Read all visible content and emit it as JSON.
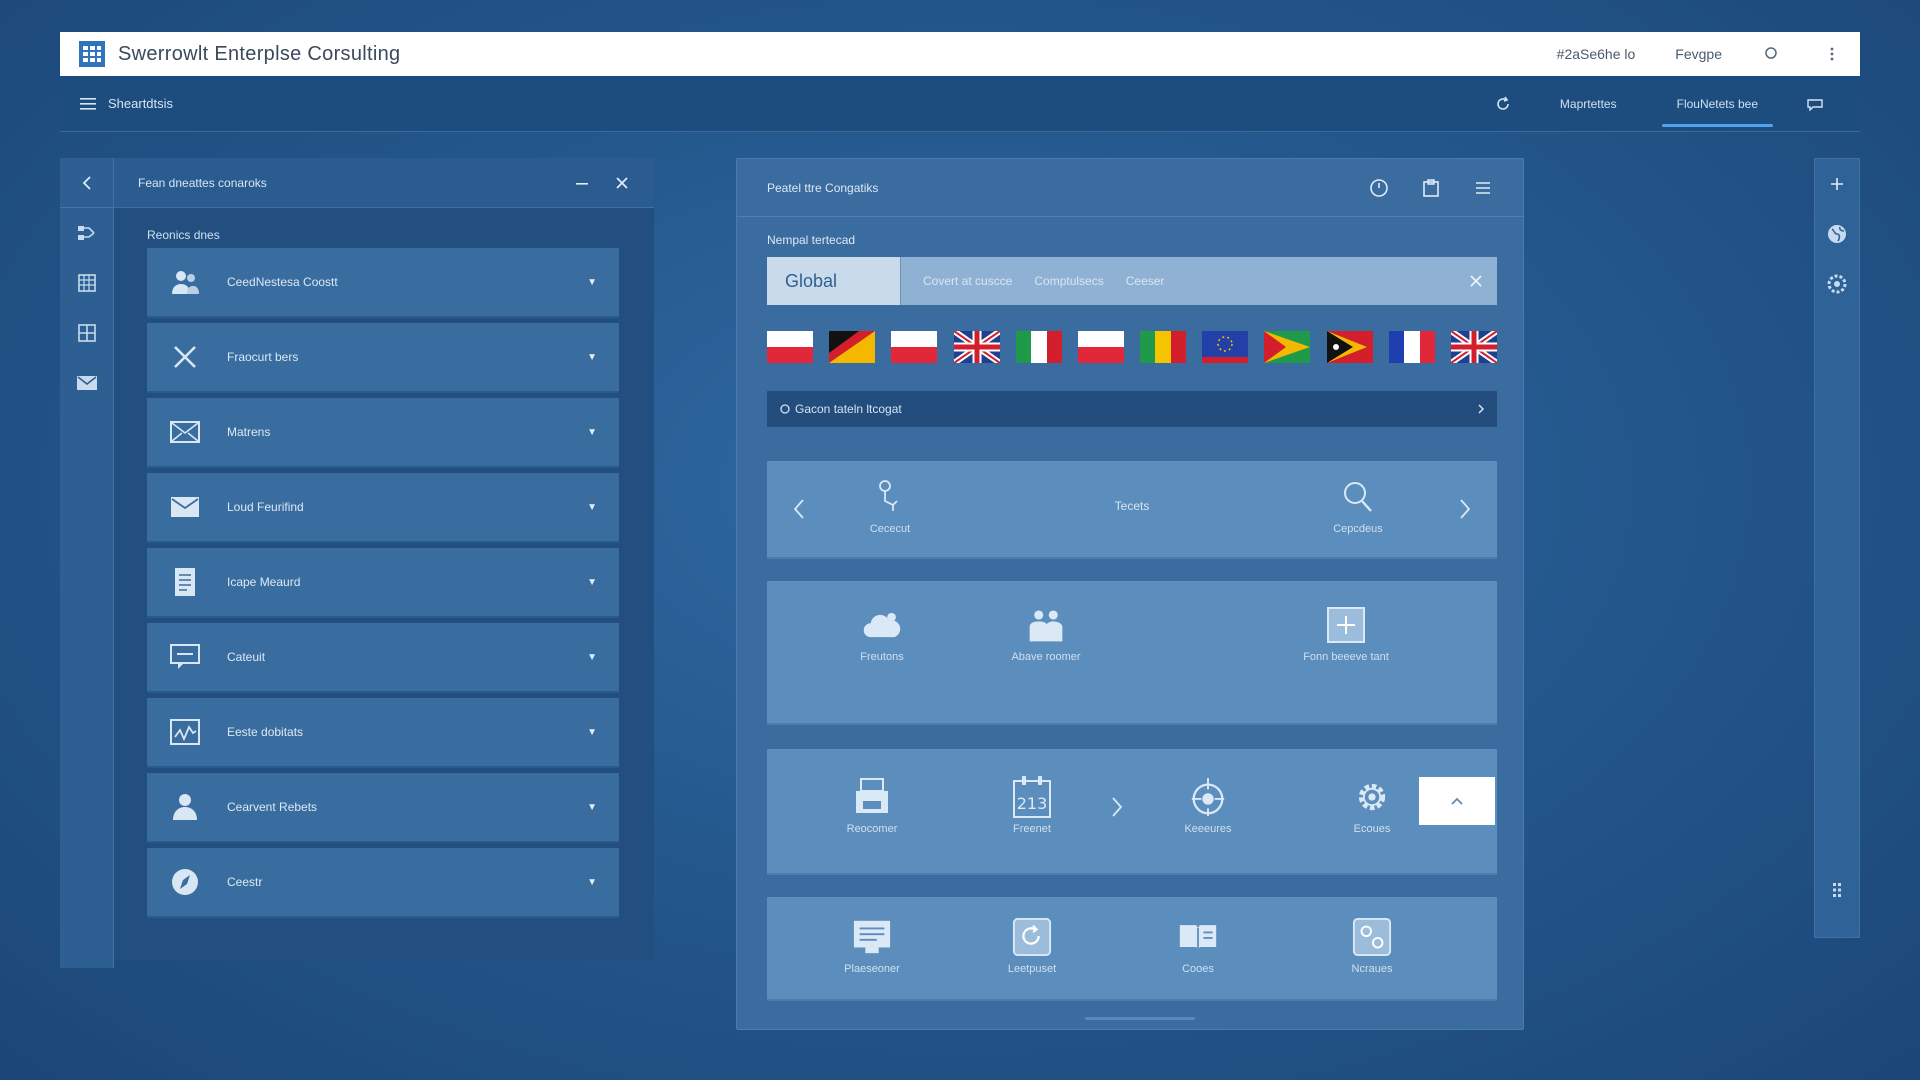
{
  "window": {
    "title": "Swerrowlt Enterplse Corsulting",
    "header_right": [
      "#2aSe6he lo",
      "Fevgpe"
    ]
  },
  "toolbar": {
    "breadcrumb": "Sheartdtsis",
    "tabs": [
      {
        "label": "Maprtettes",
        "active": false
      },
      {
        "label": "FlouNetets bee",
        "active": true
      }
    ]
  },
  "left_panel": {
    "title": "Fean dneattes conaroks",
    "section_label": "Reonics dnes",
    "items": [
      {
        "label": "CeedNestesa Coostt",
        "icon": "users-icon"
      },
      {
        "label": "Fraocurt bers",
        "icon": "close-x-icon"
      },
      {
        "label": "Matrens",
        "icon": "mail-icon"
      },
      {
        "label": "Loud Feurifind",
        "icon": "envelope-open-icon"
      },
      {
        "label": "Icape Meaurd",
        "icon": "document-icon"
      },
      {
        "label": "Cateuit",
        "icon": "chat-icon"
      },
      {
        "label": "Eeste dobitats",
        "icon": "chart-icon"
      },
      {
        "label": "Cearvent Rebets",
        "icon": "person-icon"
      },
      {
        "label": "Ceestr",
        "icon": "compass-icon"
      }
    ]
  },
  "center_panel": {
    "title": "Peatel ttre Congatiks",
    "field_label": "Nempal tertecad",
    "search": {
      "value": "Global",
      "chips": [
        "Covert at cuscce",
        "Comptulsecs",
        "Ceeser"
      ]
    },
    "status_text": "Gacon tateln ltcogat",
    "row1": {
      "left_label": "Cececut",
      "mid_label": "Tecets",
      "right_label": "Cepcdeus"
    },
    "row2": [
      {
        "label": "Freutons",
        "icon": "cloud-icon"
      },
      {
        "label": "Abave roomer",
        "icon": "team-icon"
      },
      {
        "label": "Fonn beeeve tant",
        "icon": "frame-icon"
      }
    ],
    "row3": [
      {
        "label": "Reocomer",
        "icon": "printer-icon"
      },
      {
        "label": "Freenet",
        "icon": "calendar-icon"
      },
      {
        "label": "Keeeures",
        "icon": "target-icon"
      },
      {
        "label": "Ecoues",
        "icon": "gear-icon"
      }
    ],
    "row4": [
      {
        "label": "Plaeseoner",
        "icon": "list-card-icon"
      },
      {
        "label": "Leetpuset",
        "icon": "refresh-card-icon"
      },
      {
        "label": "Cooes",
        "icon": "book-icon"
      },
      {
        "label": "Ncraues",
        "icon": "contacts-icon"
      }
    ]
  },
  "flags": [
    {
      "name": "poland-flag"
    },
    {
      "name": "germany-like-flag"
    },
    {
      "name": "poland-flag-2"
    },
    {
      "name": "uk-flag"
    },
    {
      "name": "italy-flag"
    },
    {
      "name": "poland-flag-3"
    },
    {
      "name": "tricolor-flag"
    },
    {
      "name": "eu-flag"
    },
    {
      "name": "green-yellow-flag"
    },
    {
      "name": "orange-black-flag"
    },
    {
      "name": "france-flag"
    },
    {
      "name": "uk-flag-2"
    }
  ],
  "colors": {
    "accent": "#4fa3ee",
    "panel": "#3a6c9f",
    "card": "#5b8dbd"
  }
}
